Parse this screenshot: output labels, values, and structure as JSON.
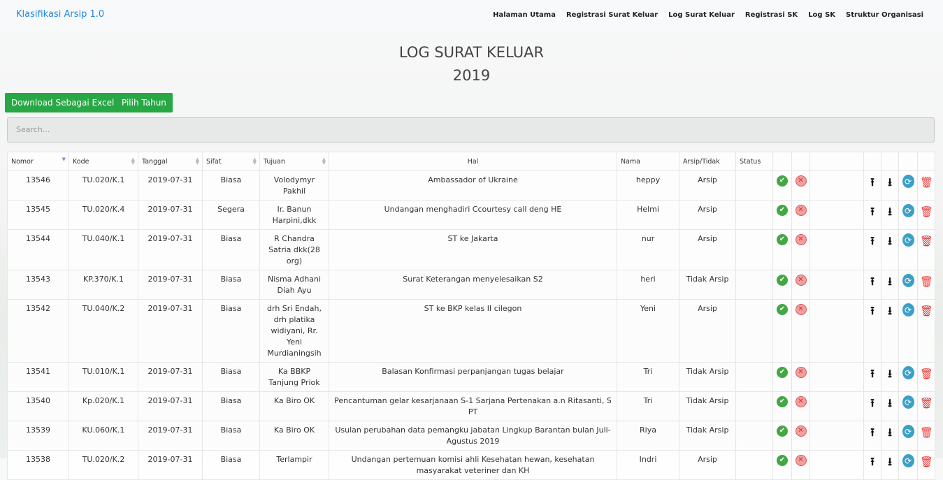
{
  "app": {
    "brand": "Klasifikasi Arsip 1.0"
  },
  "nav": [
    "Halaman Utama",
    "Registrasi Surat Keluar",
    "Log Surat Keluar",
    "Registrasi SK",
    "Log SK",
    "Struktur Organisasi"
  ],
  "page": {
    "title": "LOG SURAT KELUAR",
    "year": "2019"
  },
  "buttons": {
    "download": "Download Sebagai Excel",
    "year": "Pilih Tahun"
  },
  "search": {
    "placeholder": "Search..."
  },
  "table": {
    "headers": [
      "Nomor",
      "Kode",
      "Tanggal",
      "Sifat",
      "Tujuan",
      "Hal",
      "Nama",
      "Arsip/Tidak",
      "Status"
    ],
    "rows": [
      {
        "nomor": "13546",
        "kode": "TU.020/K.1",
        "tanggal": "2019-07-31",
        "sifat": "Biasa",
        "tujuan": "Volodymyr Pakhil",
        "hal": "Ambassador of Ukraine",
        "nama": "heppy",
        "arsip": "Arsip"
      },
      {
        "nomor": "13545",
        "kode": "TU.020/K.4",
        "tanggal": "2019-07-31",
        "sifat": "Segera",
        "tujuan": "Ir. Banun Harpini,dkk",
        "hal": "Undangan menghadiri Ccourtesy call deng HE",
        "nama": "Helmi",
        "arsip": "Arsip"
      },
      {
        "nomor": "13544",
        "kode": "TU.040/K.1",
        "tanggal": "2019-07-31",
        "sifat": "Biasa",
        "tujuan": "R Chandra Satria dkk(28 org)",
        "hal": "ST ke Jakarta",
        "nama": "nur",
        "arsip": "Arsip"
      },
      {
        "nomor": "13543",
        "kode": "KP.370/K.1",
        "tanggal": "2019-07-31",
        "sifat": "Biasa",
        "tujuan": "Nisma Adhani Diah Ayu",
        "hal": "Surat Keterangan menyelesaikan S2",
        "nama": "heri",
        "arsip": "Tidak Arsip"
      },
      {
        "nomor": "13542",
        "kode": "TU.040/K.2",
        "tanggal": "2019-07-31",
        "sifat": "Biasa",
        "tujuan": "drh Sri Endah, drh platika widiyani, Rr. Yeni Murdianingsih",
        "hal": "ST ke BKP kelas II cilegon",
        "nama": "Yeni",
        "arsip": "Arsip"
      },
      {
        "nomor": "13541",
        "kode": "TU.010/K.1",
        "tanggal": "2019-07-31",
        "sifat": "Biasa",
        "tujuan": "Ka BBKP Tanjung Priok",
        "hal": "Balasan Konfirmasi perpanjangan tugas belajar",
        "nama": "Tri",
        "arsip": "Tidak Arsip"
      },
      {
        "nomor": "13540",
        "kode": "Kp.020/K.1",
        "tanggal": "2019-07-31",
        "sifat": "Biasa",
        "tujuan": "Ka Biro OK",
        "hal": "Pencantuman gelar kesarjanaan S-1 Sarjana Pertenakan a.n Ritasanti, S PT",
        "nama": "Tri",
        "arsip": "Tidak Arsip"
      },
      {
        "nomor": "13539",
        "kode": "KU.060/K.1",
        "tanggal": "2019-07-31",
        "sifat": "Biasa",
        "tujuan": "Ka Biro OK",
        "hal": "Usulan perubahan data pemangku jabatan Lingkup Barantan bulan Juli-Agustus 2019",
        "nama": "Riya",
        "arsip": "Tidak Arsip"
      },
      {
        "nomor": "13538",
        "kode": "TU.020/K.2",
        "tanggal": "2019-07-31",
        "sifat": "Biasa",
        "tujuan": "Terlampir",
        "hal": "Undangan pertemuan komisi ahli Kesehatan hewan, kesehatan masyarakat veteriner dan KH",
        "nama": "Indri",
        "arsip": "Arsip"
      }
    ]
  },
  "icons": {
    "approve": "check-circle-icon",
    "reject": "x-circle-icon",
    "upload": "upload-icon",
    "download": "download-icon",
    "refresh": "refresh-icon",
    "delete": "trash-icon"
  },
  "colors": {
    "brand": "#1e88e5",
    "button": "#28a745",
    "approve": "#43a743",
    "reject": "#e53935",
    "refresh": "#3aa0c8"
  }
}
